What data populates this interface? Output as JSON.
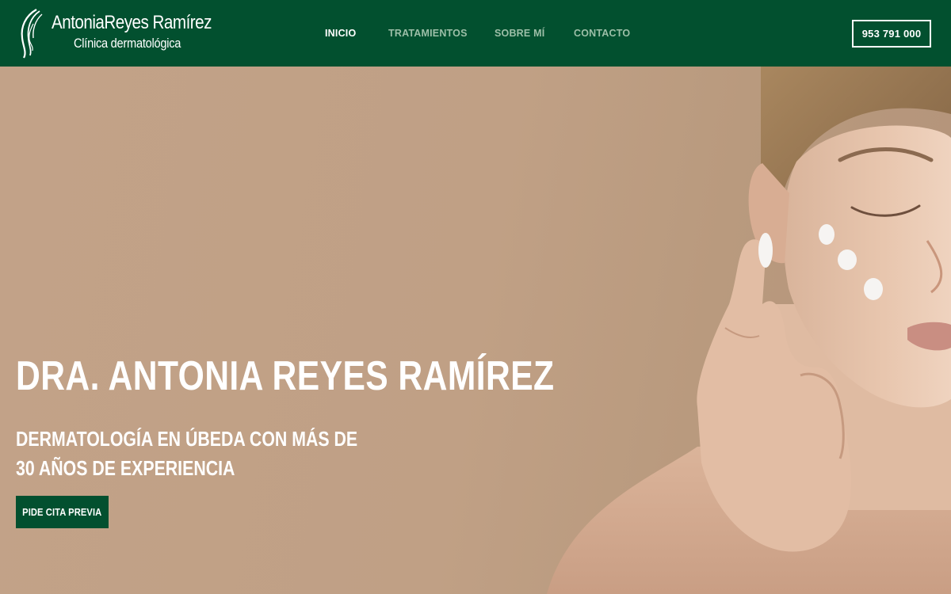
{
  "brand": {
    "name": "AntoniaReyes Ramírez",
    "tagline": "Clínica dermatológica",
    "logo_icon": "woman-profile-icon"
  },
  "nav": {
    "items": [
      {
        "label": "INICIO",
        "active": true
      },
      {
        "label": "TRATAMIENTOS",
        "active": false
      },
      {
        "label": "SOBRE MÍ",
        "active": false
      },
      {
        "label": "CONTACTO",
        "active": false
      }
    ]
  },
  "header": {
    "phone": "953 791 000"
  },
  "hero": {
    "title": "DRA. ANTONIA REYES RAMÍREZ",
    "subtitle_line1": "DERMATOLOGÍA EN ÚBEDA CON MÁS DE",
    "subtitle_line2": "30 AÑOS DE EXPERIENCIA",
    "cta_label": "PIDE CITA PREVIA"
  },
  "colors": {
    "brand_green": "#02502f",
    "hero_background": "#c2a288",
    "nav_inactive": "#9dbfa8",
    "text_light": "#ffffff"
  }
}
